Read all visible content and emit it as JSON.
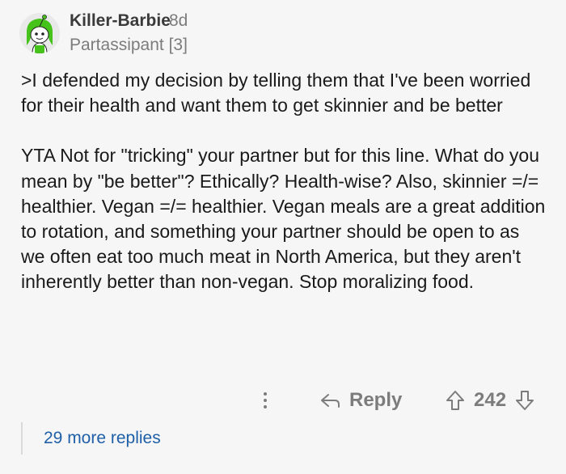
{
  "comment": {
    "username": "Killer-Barbie",
    "age": "8d",
    "flair": "Partassipant [3]",
    "quote": ">I defended my decision by telling them that I've been worried for their health and want them to get skinnier and be better",
    "reply_text": "YTA Not for \"tricking\" your partner but for this line. What do you mean by \"be better\"? Ethically? Health-wise? Also, skinnier =/= healthier. Vegan =/= healthier. Vegan meals are a great addition to rotation, and something your partner should be open to as we often eat too much meat in North America, but they aren't inherently better than non-vegan. Stop moralizing food."
  },
  "actions": {
    "more_icon": "more-vertical-icon",
    "reply_icon": "reply-arrow-icon",
    "reply_label": "Reply",
    "upvote_icon": "upvote-arrow-icon",
    "score": "242",
    "downvote_icon": "downvote-arrow-icon"
  },
  "more_replies": "29 more replies",
  "colors": {
    "background": "#f6f6f6",
    "muted": "#7c7c7c",
    "link": "#1f5fa8",
    "avatar_accent": "#46c31a"
  }
}
